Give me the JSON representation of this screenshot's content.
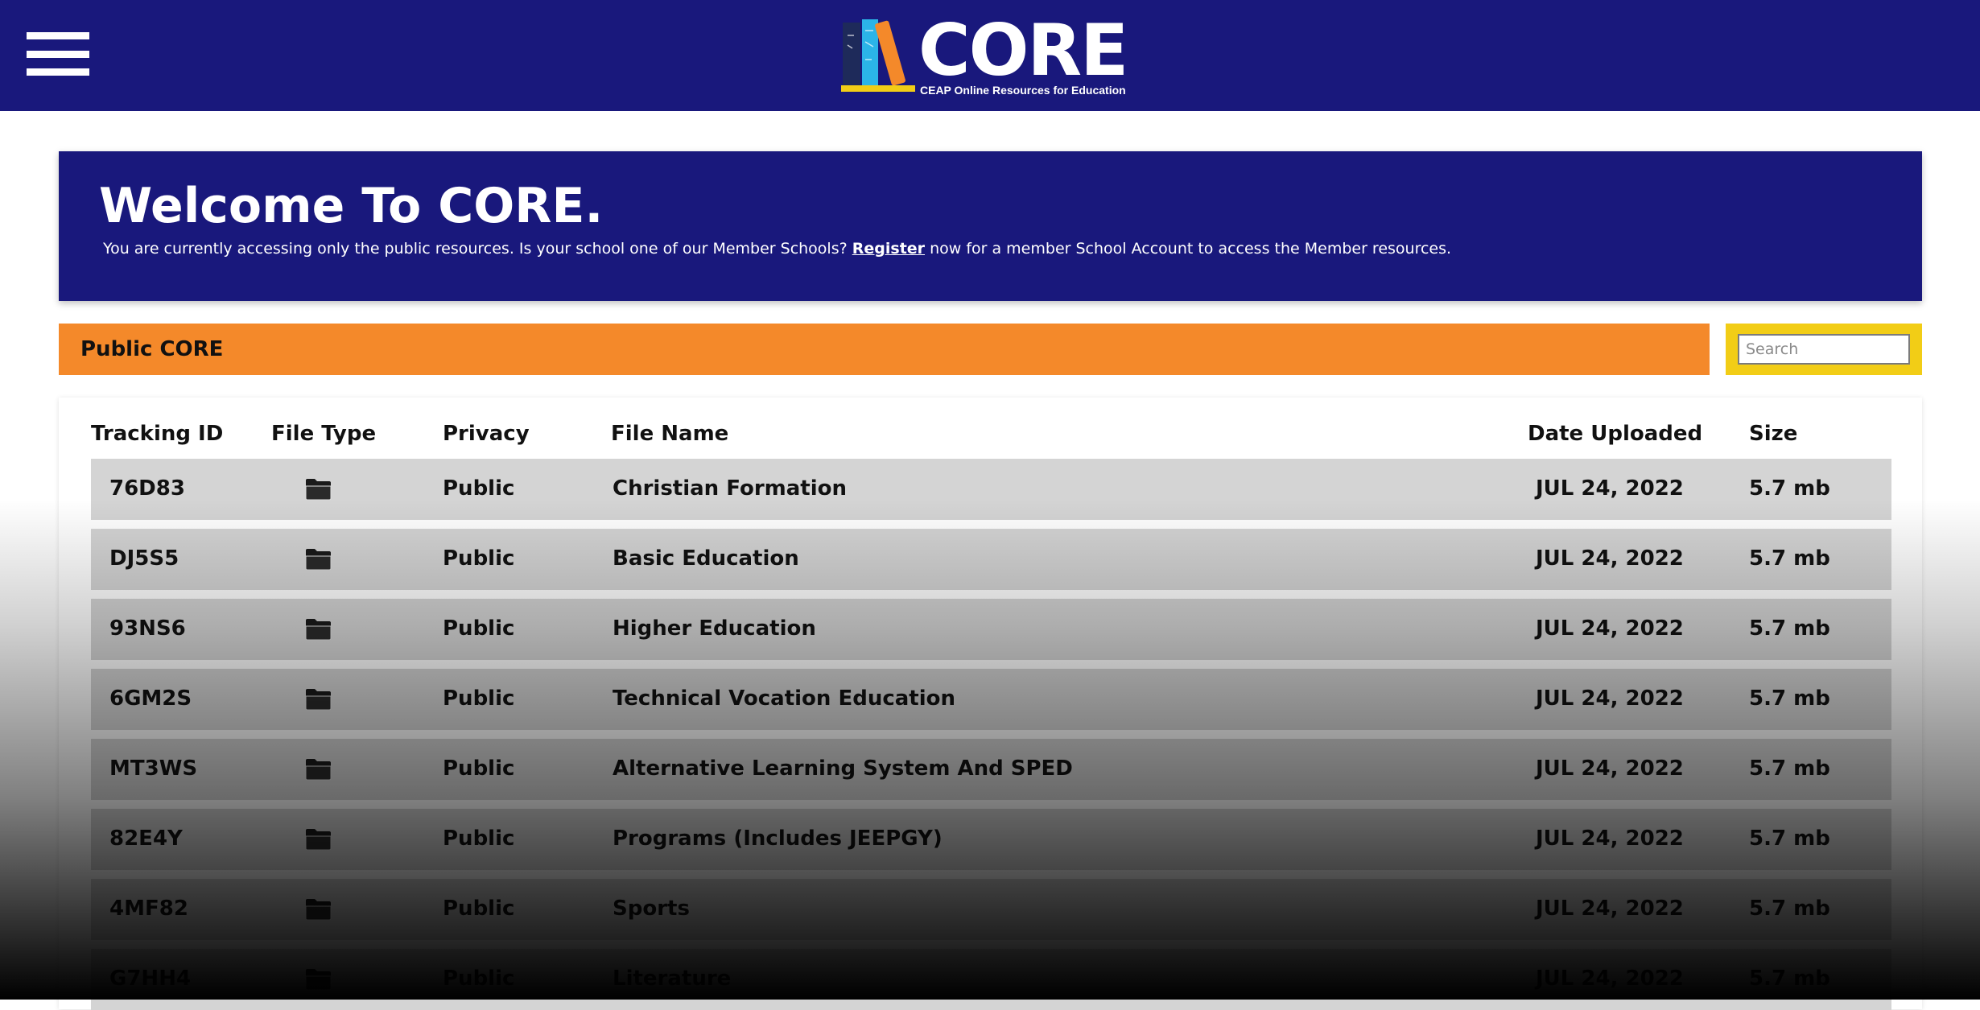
{
  "header": {
    "menu_icon": "hamburger-menu-icon",
    "logo_word": "CORE",
    "logo_tagline": "CEAP Online Resources for Education"
  },
  "welcome": {
    "title": "Welcome To CORE.",
    "text_before": "You are currently accessing only the public resources. Is your school one of our Member Schools?",
    "register_link": "Register",
    "text_after": "now for a member School Account to access the Member resources."
  },
  "section": {
    "title": "Public CORE"
  },
  "search": {
    "placeholder": "Search",
    "value": ""
  },
  "table": {
    "columns": [
      "Tracking ID",
      "File Type",
      "Privacy",
      "File Name",
      "Date Uploaded",
      "Size"
    ],
    "rows": [
      {
        "id": "76D83",
        "type_icon": "folder-icon",
        "privacy": "Public",
        "name": "Christian Formation",
        "date": "JUL 24, 2022",
        "size": "5.7 mb"
      },
      {
        "id": "DJ5S5",
        "type_icon": "folder-icon",
        "privacy": "Public",
        "name": "Basic Education",
        "date": "JUL 24, 2022",
        "size": "5.7 mb"
      },
      {
        "id": "93NS6",
        "type_icon": "folder-icon",
        "privacy": "Public",
        "name": "Higher Education",
        "date": "JUL 24, 2022",
        "size": "5.7 mb"
      },
      {
        "id": "6GM2S",
        "type_icon": "folder-icon",
        "privacy": "Public",
        "name": "Technical Vocation Education",
        "date": "JUL 24, 2022",
        "size": "5.7 mb"
      },
      {
        "id": "MT3WS",
        "type_icon": "folder-icon",
        "privacy": "Public",
        "name": "Alternative Learning System And SPED",
        "date": "JUL 24, 2022",
        "size": "5.7 mb"
      },
      {
        "id": "82E4Y",
        "type_icon": "folder-icon",
        "privacy": "Public",
        "name": "Programs (Includes JEEPGY)",
        "date": "JUL 24, 2022",
        "size": "5.7 mb"
      },
      {
        "id": "4MF82",
        "type_icon": "folder-icon",
        "privacy": "Public",
        "name": "Sports",
        "date": "JUL 24, 2022",
        "size": "5.7 mb"
      },
      {
        "id": "G7HH4",
        "type_icon": "folder-icon",
        "privacy": "Public",
        "name": "Literature",
        "date": "JUL 24, 2022",
        "size": "5.7 mb"
      }
    ]
  },
  "colors": {
    "navy": "#19187c",
    "orange": "#f4892a",
    "yellow": "#f2cd16",
    "row_gray": "#d4d4d4"
  }
}
